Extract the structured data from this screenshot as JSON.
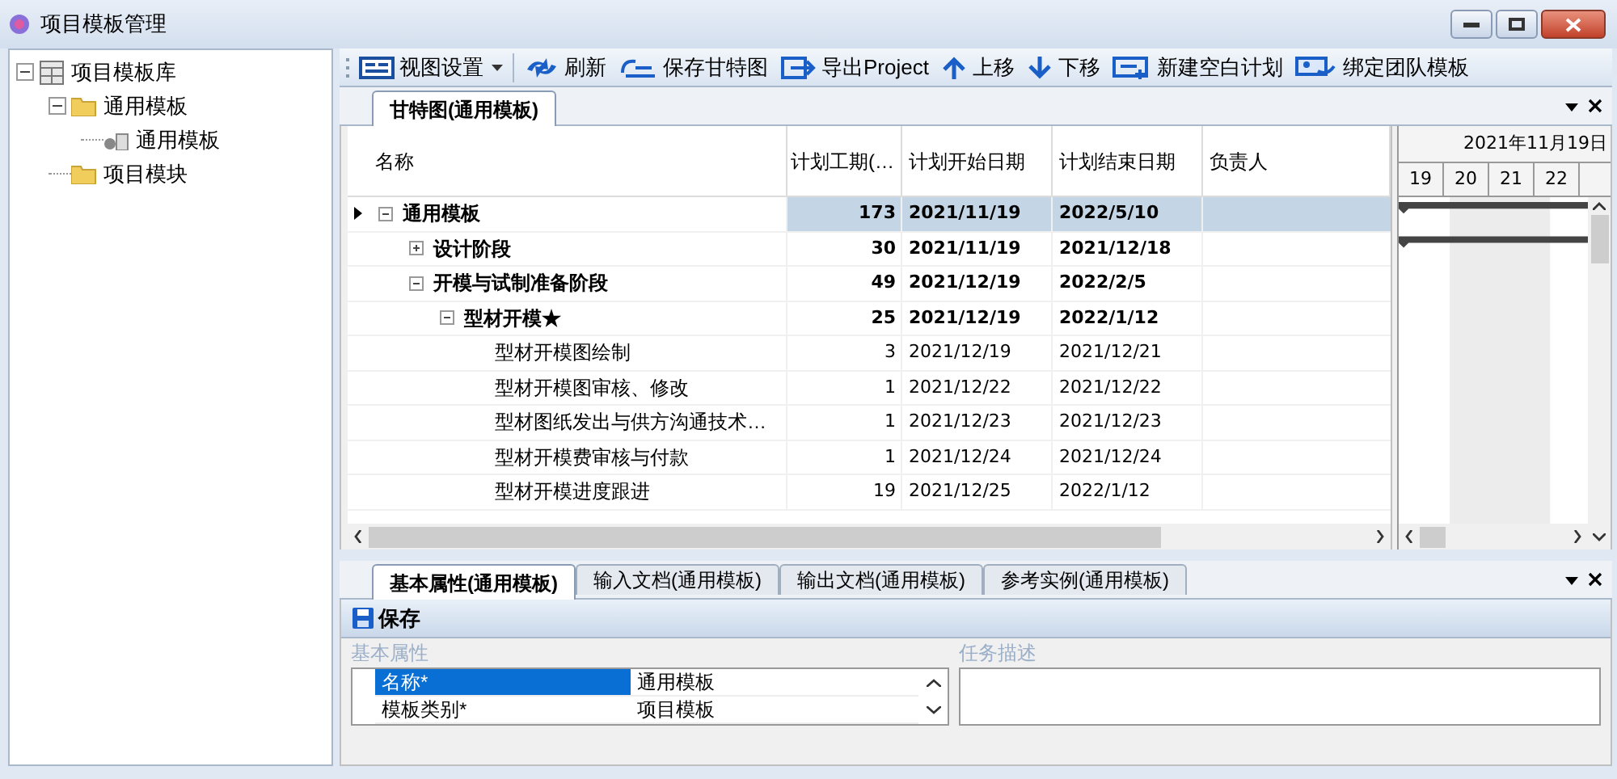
{
  "window": {
    "title": "项目模板管理"
  },
  "tree": [
    {
      "label": "项目模板库",
      "kind": "library",
      "expanded": true,
      "children": [
        {
          "label": "通用模板",
          "kind": "folder",
          "expanded": true,
          "children": [
            {
              "label": "通用模板",
              "kind": "template"
            }
          ]
        },
        {
          "label": "项目模块",
          "kind": "folder"
        }
      ]
    }
  ],
  "toolbar": [
    {
      "label": "视图设置",
      "kind": "view",
      "dropdown": true
    },
    {
      "label": "刷新",
      "kind": "refresh"
    },
    {
      "label": "保存甘特图",
      "kind": "gantt"
    },
    {
      "label": "导出Project",
      "kind": "export"
    },
    {
      "label": "上移",
      "kind": "up"
    },
    {
      "label": "下移",
      "kind": "down"
    },
    {
      "label": "新建空白计划",
      "kind": "new"
    },
    {
      "label": "绑定团队模板",
      "kind": "team"
    }
  ],
  "top_tabs": [
    {
      "label": "甘特图(通用模板)",
      "selected": true
    }
  ],
  "grid": {
    "columns": [
      "名称",
      "计划工期(…",
      "计划开始日期",
      "计划结束日期",
      "负责人"
    ],
    "rows": [
      {
        "name": "通用模板",
        "duration": "173",
        "start": "2021/11/19",
        "end": "2022/5/10",
        "selected": true,
        "expanded": true,
        "children": [
          {
            "name": "设计阶段",
            "duration": "30",
            "start": "2021/11/19",
            "end": "2021/12/18",
            "selected": false,
            "expanded": false
          },
          {
            "name": "开模与试制准备阶段",
            "duration": "49",
            "start": "2021/12/19",
            "end": "2022/2/5",
            "selected": false,
            "expanded": true,
            "children": [
              {
                "name": "型材开模★",
                "duration": "25",
                "start": "2021/12/19",
                "end": "2022/1/12",
                "selected": false,
                "expanded": true,
                "children": [
                  {
                    "name": "型材开模图绘制",
                    "duration": "3",
                    "start": "2021/12/19",
                    "end": "2021/12/21",
                    "selected": false
                  },
                  {
                    "name": "型材开模图审核、修改",
                    "duration": "1",
                    "start": "2021/12/22",
                    "end": "2021/12/22",
                    "selected": false
                  },
                  {
                    "name": "型材图纸发出与供方沟通技术…",
                    "duration": "1",
                    "start": "2021/12/23",
                    "end": "2021/12/23",
                    "selected": false
                  },
                  {
                    "name": "型材开模费审核与付款",
                    "duration": "1",
                    "start": "2021/12/24",
                    "end": "2021/12/24",
                    "selected": false
                  },
                  {
                    "name": "型材开模进度跟进",
                    "duration": "19",
                    "start": "2021/12/25",
                    "end": "2022/1/12",
                    "selected": false
                  }
                ]
              }
            ]
          }
        ]
      }
    ]
  },
  "gantt": {
    "month": "2021年11月19日",
    "days": [
      "19",
      "20",
      "21",
      "22"
    ]
  },
  "bottom_tabs": [
    {
      "label": "基本属性(通用模板)",
      "selected": true
    },
    {
      "label": "输入文档(通用模板)",
      "selected": false
    },
    {
      "label": "输出文档(通用模板)",
      "selected": false
    },
    {
      "label": "参考实例(通用模板)",
      "selected": false
    }
  ],
  "save_button": "保存",
  "properties": {
    "title": "基本属性",
    "rows": [
      {
        "name": "名称*",
        "value": "通用模板",
        "selected": true
      },
      {
        "name": "模板类别*",
        "value": "项目模板",
        "selected": false
      }
    ]
  },
  "description": {
    "title": "任务描述"
  }
}
